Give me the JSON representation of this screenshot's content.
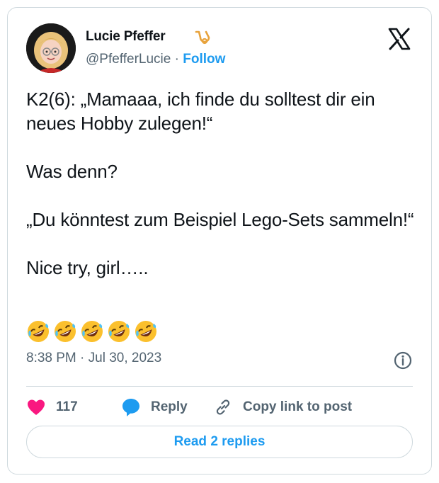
{
  "author": {
    "name": "Lucie Pfeffer",
    "handle": "@PfefferLucie",
    "separator": "·",
    "follow_label": "Follow",
    "avatar_icon": "avatar-cartoon-woman-blonde-glasses",
    "badge_icon": "horn-badge-icon"
  },
  "tweet": {
    "text": "K2(6): „Mamaaa, ich finde du solltest dir ein neues Hobby zulegen!“\n\nWas denn?\n\n„Du könntest zum Beispiel Lego-Sets sammeln!“\n\nNice try, girl…..",
    "emoji": "🤣🤣🤣🤣🤣",
    "emoji_count": 5
  },
  "meta": {
    "time": "8:38 PM",
    "separator": "·",
    "date": "Jul 30, 2023"
  },
  "actions": {
    "likes_count": "117",
    "reply_label": "Reply",
    "copy_link_label": "Copy link to post"
  },
  "footer": {
    "read_replies_label": "Read 2 replies"
  },
  "colors": {
    "accent": "#1d9bf0",
    "like": "#f91880",
    "muted_text": "#536471",
    "border": "#cfd9de",
    "text": "#0f1419"
  }
}
